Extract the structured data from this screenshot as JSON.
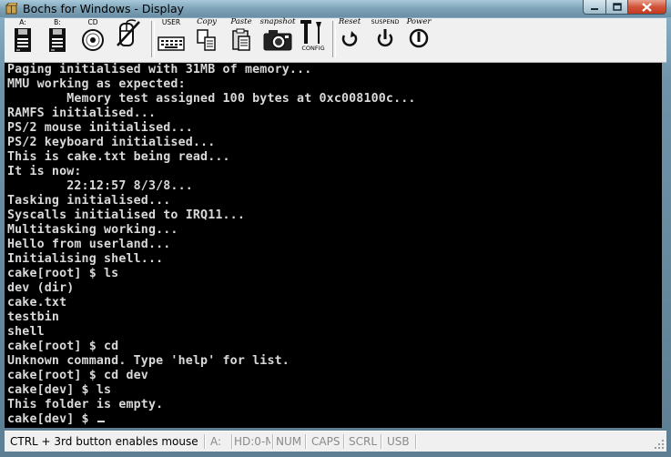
{
  "window": {
    "title": "Bochs for Windows - Display"
  },
  "toolbar": {
    "buttons": [
      {
        "id": "floppy-a",
        "label": "A:",
        "icon": "floppy-icon"
      },
      {
        "id": "floppy-b",
        "label": "B:",
        "icon": "floppy-icon"
      },
      {
        "id": "cdrom",
        "label": "CD",
        "icon": "cdrom-icon"
      },
      {
        "id": "mouse",
        "label": "",
        "icon": "mouse-icon"
      },
      {
        "id": "user",
        "label": "USER",
        "icon": "keyboard-icon"
      },
      {
        "id": "copy",
        "label": "Copy",
        "icon": "copy-icon"
      },
      {
        "id": "paste",
        "label": "Paste",
        "icon": "paste-icon"
      },
      {
        "id": "snapshot",
        "label": "snapshot",
        "icon": "camera-icon"
      },
      {
        "id": "config",
        "label": "CONFIG",
        "icon": "config-icon"
      },
      {
        "id": "reset",
        "label": "Reset",
        "icon": "reset-icon"
      },
      {
        "id": "suspend",
        "label": "SUSPEND",
        "icon": "suspend-icon"
      },
      {
        "id": "power",
        "label": "Power",
        "icon": "power-icon"
      }
    ]
  },
  "console": {
    "lines": [
      "Paging initialised with 31MB of memory...",
      "MMU working as expected:",
      "        Memory test assigned 100 bytes at 0xc008100c...",
      "RAMFS initialised...",
      "PS/2 mouse initialised...",
      "PS/2 keyboard initialised...",
      "This is cake.txt being read...",
      "It is now:",
      "        22:12:57 8/3/8...",
      "Tasking initialised...",
      "Syscalls initialised to IRQ11...",
      "Multitasking working...",
      "Hello from userland...",
      "Initialising shell...",
      "cake[root] $ ls",
      "dev (dir)",
      "cake.txt",
      "testbin",
      "shell",
      "cake[root] $ cd",
      "Unknown command. Type 'help' for list.",
      "cake[root] $ cd dev",
      "cake[dev] $ ls",
      "This folder is empty.",
      "cake[dev] $ "
    ]
  },
  "statusbar": {
    "message": "CTRL + 3rd button enables mouse",
    "drive": "A:",
    "hd": "HD:0-M",
    "num": "NUM",
    "caps": "CAPS",
    "scrl": "SCRL",
    "usb": "USB"
  },
  "colors": {
    "console_bg": "#000000",
    "console_fg": "#d9d9d9",
    "close_button": "#c23a1f"
  }
}
